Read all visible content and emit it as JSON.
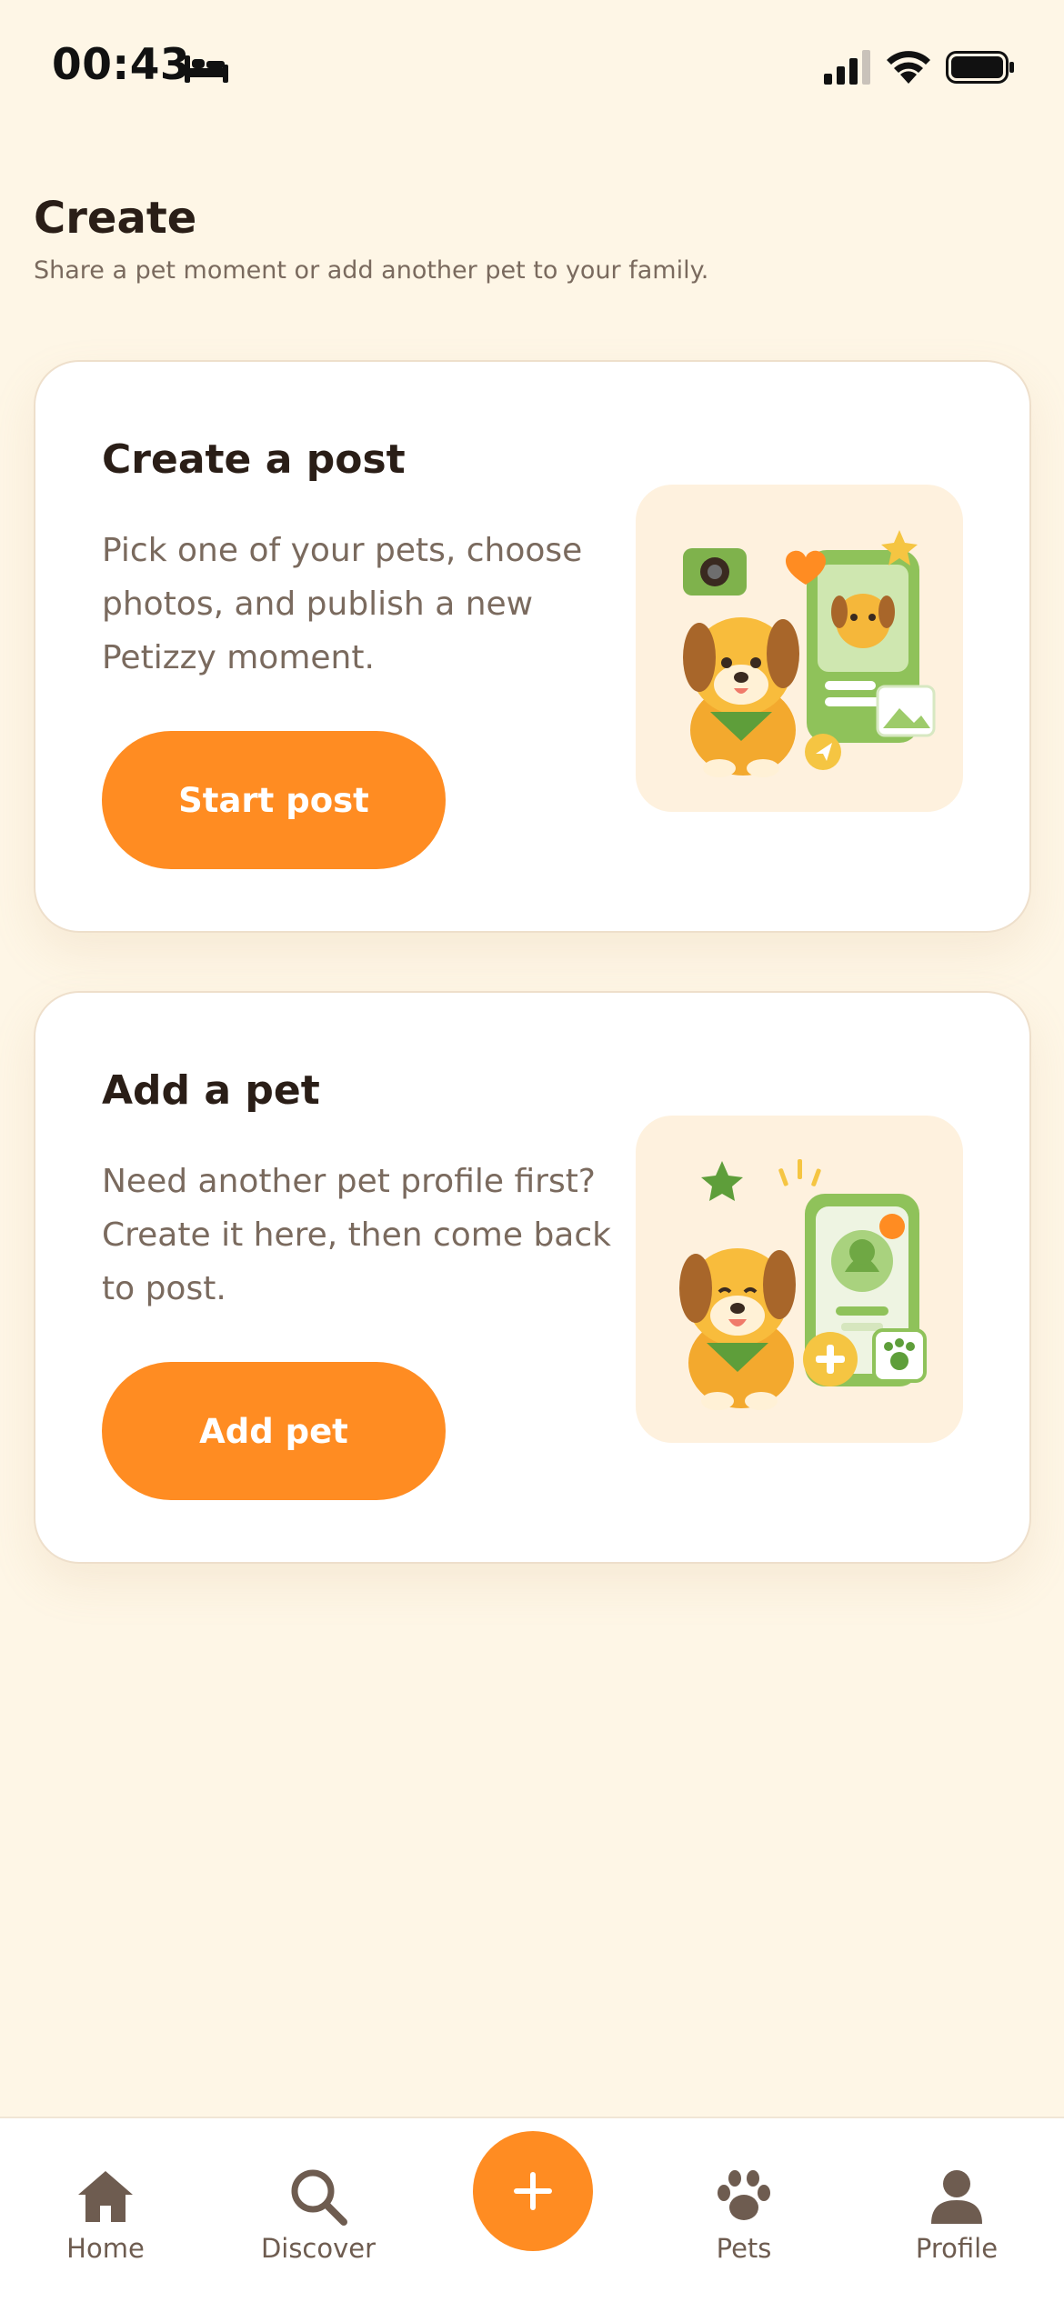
{
  "status_bar": {
    "time": "00:43",
    "icons": [
      "bed-icon",
      "signal-icon",
      "wifi-icon",
      "battery-icon"
    ]
  },
  "header": {
    "title": "Create",
    "subtitle": "Share a pet moment or add another pet to your family."
  },
  "cards": [
    {
      "title": "Create a post",
      "description": "Pick one of your pets, choose photos, and publish a new Petizzy moment.",
      "button_label": "Start post",
      "illustration": "puppy-camera-phone-illustration"
    },
    {
      "title": "Add a pet",
      "description": "Need another pet profile first? Create it here, then come back to post.",
      "button_label": "Add pet",
      "illustration": "puppy-add-pet-illustration"
    }
  ],
  "bottom_nav": {
    "items": [
      {
        "label": "Home",
        "icon": "home-icon"
      },
      {
        "label": "Discover",
        "icon": "search-icon"
      },
      {
        "label": "",
        "icon": "plus-icon"
      },
      {
        "label": "Pets",
        "icon": "paw-icon"
      },
      {
        "label": "Profile",
        "icon": "person-icon"
      }
    ]
  },
  "colors": {
    "background": "#FEF6E6",
    "card": "#FFFFFF",
    "accent": "#FF8C22",
    "title_text": "#2A1E17",
    "muted_text": "#7A6A5E",
    "nav_icon": "#6E5C50"
  }
}
